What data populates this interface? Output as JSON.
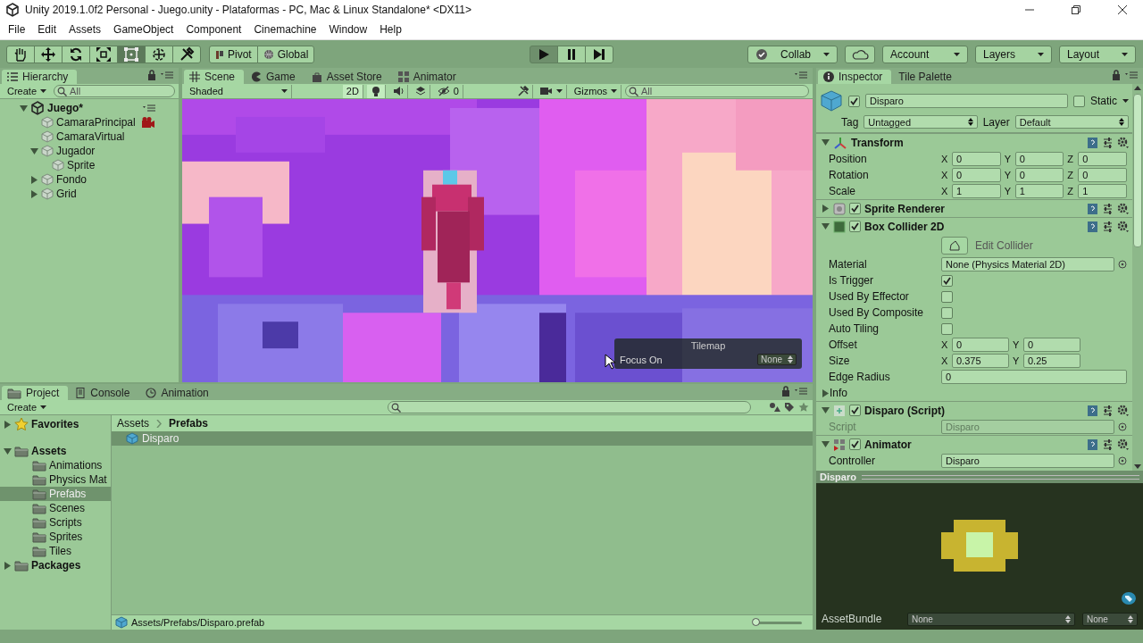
{
  "window": {
    "title": "Unity 2019.1.0f2 Personal - Juego.unity - Plataformas - PC, Mac & Linux Standalone* <DX11>"
  },
  "menu": [
    "File",
    "Edit",
    "Assets",
    "GameObject",
    "Component",
    "Cinemachine",
    "Window",
    "Help"
  ],
  "toolbar": {
    "tools": [
      {
        "kind": "hand",
        "selected": false
      },
      {
        "kind": "move",
        "selected": false
      },
      {
        "kind": "rotate",
        "selected": false
      },
      {
        "kind": "scale",
        "selected": false
      },
      {
        "kind": "rect",
        "selected": true
      },
      {
        "kind": "transform",
        "selected": false
      },
      {
        "kind": "custom",
        "selected": false
      }
    ],
    "pivot": [
      {
        "kind": "pivot",
        "label": "Pivot"
      },
      {
        "kind": "global",
        "label": "Global"
      }
    ],
    "playback": [
      {
        "kind": "play",
        "selected": true
      },
      {
        "kind": "pause",
        "selected": false
      },
      {
        "kind": "step",
        "selected": false
      }
    ],
    "collab": "Collab",
    "account": "Account",
    "layers": "Layers",
    "layout": "Layout"
  },
  "hierarchy": {
    "tab": "Hierarchy",
    "create": "Create",
    "search": {
      "placeholder": "All"
    },
    "tree": [
      {
        "label": "Juego*",
        "kind": "scene",
        "expanded": true,
        "children": [
          {
            "label": "CamaraPrincipal",
            "kind": "brain_camera"
          },
          {
            "label": "CamaraVirtual",
            "kind": "object"
          },
          {
            "label": "Jugador",
            "kind": "object",
            "expanded": true,
            "children": [
              {
                "label": "Sprite",
                "kind": "object"
              }
            ]
          },
          {
            "label": "Fondo",
            "kind": "object",
            "expanded": false
          },
          {
            "label": "Grid",
            "kind": "object",
            "expanded": false
          }
        ]
      }
    ]
  },
  "scene": {
    "tabs": [
      {
        "kind": "scene",
        "label": "Scene",
        "selected": true
      },
      {
        "kind": "game",
        "label": "Game",
        "selected": false
      },
      {
        "kind": "store",
        "label": "Asset Store",
        "selected": false
      },
      {
        "kind": "animator",
        "label": "Animator",
        "selected": false
      }
    ],
    "shading": "Shaded",
    "mode_2d": {
      "label": "2D",
      "on": true
    },
    "toggles": [
      {
        "kind": "light",
        "on": true
      },
      {
        "kind": "audio",
        "on": false
      },
      {
        "kind": "effects",
        "on": false
      }
    ],
    "hidden_count": "0",
    "gizmos": "Gizmos",
    "search": {
      "placeholder": "All"
    },
    "overlay": {
      "title": "Tilemap",
      "label": "Focus On",
      "value": "None"
    }
  },
  "inspector": {
    "tabs": [
      {
        "kind": "inspector",
        "label": "Inspector",
        "selected": true
      },
      {
        "kind": "palette",
        "label": "Tile Palette",
        "selected": false
      }
    ],
    "object": {
      "active": true,
      "name": "Disparo",
      "static": false,
      "static_label": "Static",
      "tag_label": "Tag",
      "tag": "Untagged",
      "layer_label": "Layer",
      "layer": "Default"
    },
    "components": [
      {
        "kind": "transform",
        "name": "Transform",
        "expanded": true,
        "properties": [
          {
            "kind": "vector",
            "label": "Position",
            "values": [
              {
                "axis": "X",
                "value": "0"
              },
              {
                "axis": "Y",
                "value": "0"
              },
              {
                "axis": "Z",
                "value": "0"
              }
            ]
          },
          {
            "kind": "vector",
            "label": "Rotation",
            "values": [
              {
                "axis": "X",
                "value": "0"
              },
              {
                "axis": "Y",
                "value": "0"
              },
              {
                "axis": "Z",
                "value": "0"
              }
            ]
          },
          {
            "kind": "vector",
            "label": "Scale",
            "values": [
              {
                "axis": "X",
                "value": "1"
              },
              {
                "axis": "Y",
                "value": "1"
              },
              {
                "axis": "Z",
                "value": "1"
              }
            ]
          }
        ]
      },
      {
        "kind": "sprite",
        "name": "Sprite Renderer",
        "enabled": true,
        "expanded": false
      },
      {
        "kind": "collider",
        "name": "Box Collider 2D",
        "enabled": true,
        "expanded": true,
        "properties": [
          {
            "kind": "button",
            "label": "Edit Collider"
          },
          {
            "kind": "object",
            "label": "Material",
            "value": "None (Physics Material 2D)",
            "disabled": false
          },
          {
            "kind": "checkbox",
            "label": "Is Trigger",
            "checked": true
          },
          {
            "kind": "checkbox",
            "label": "Used By Effector",
            "checked": false
          },
          {
            "kind": "checkbox",
            "label": "Used By Composite",
            "checked": false
          },
          {
            "kind": "checkbox",
            "label": "Auto Tiling",
            "checked": false
          },
          {
            "kind": "vector",
            "label": "Offset",
            "values": [
              {
                "axis": "X",
                "value": "0"
              },
              {
                "axis": "Y",
                "value": "0"
              }
            ]
          },
          {
            "kind": "vector",
            "label": "Size",
            "values": [
              {
                "axis": "X",
                "value": "0.375"
              },
              {
                "axis": "Y",
                "value": "0.25"
              }
            ]
          },
          {
            "kind": "number",
            "label": "Edge Radius",
            "value": "0"
          },
          {
            "kind": "foldout",
            "label": "Info",
            "expanded": false
          }
        ]
      },
      {
        "kind": "script",
        "name": "Disparo (Script)",
        "enabled": true,
        "expanded": true,
        "properties": [
          {
            "kind": "object",
            "label": "Script",
            "value": "Disparo",
            "disabled": true
          }
        ]
      },
      {
        "kind": "animator",
        "name": "Animator",
        "enabled": true,
        "expanded": true,
        "properties": [
          {
            "kind": "object",
            "label": "Controller",
            "value": "Disparo",
            "disabled": false
          }
        ]
      }
    ],
    "preview": {
      "title": "Disparo",
      "assetbundle_label": "AssetBundle",
      "bundle": "None",
      "variant": "None"
    }
  },
  "project": {
    "tabs": [
      {
        "kind": "project",
        "label": "Project",
        "selected": true
      },
      {
        "kind": "console",
        "label": "Console",
        "selected": false
      },
      {
        "kind": "animation",
        "label": "Animation",
        "selected": false
      }
    ],
    "create": "Create",
    "tree": [
      {
        "label": "Favorites",
        "kind": "favorites",
        "expanded": false,
        "selected": false
      },
      {
        "label": "Assets",
        "kind": "folder",
        "expanded": true,
        "selected": false,
        "children": [
          {
            "label": "Animations",
            "kind": "folder",
            "selected": false
          },
          {
            "label": "Physics Mat",
            "kind": "folder",
            "selected": false
          },
          {
            "label": "Prefabs",
            "kind": "folder",
            "selected": true
          },
          {
            "label": "Scenes",
            "kind": "folder",
            "selected": false
          },
          {
            "label": "Scripts",
            "kind": "folder",
            "selected": false
          },
          {
            "label": "Sprites",
            "kind": "folder",
            "selected": false
          },
          {
            "label": "Tiles",
            "kind": "folder",
            "selected": false
          }
        ]
      },
      {
        "label": "Packages",
        "kind": "folder",
        "expanded": false,
        "selected": false
      }
    ],
    "breadcrumb": [
      "Assets",
      "Prefabs"
    ],
    "items": [
      {
        "label": "Disparo",
        "selected": true
      }
    ],
    "path": "Assets/Prefabs/Disparo.prefab",
    "zoom": {
      "level": 0
    }
  }
}
